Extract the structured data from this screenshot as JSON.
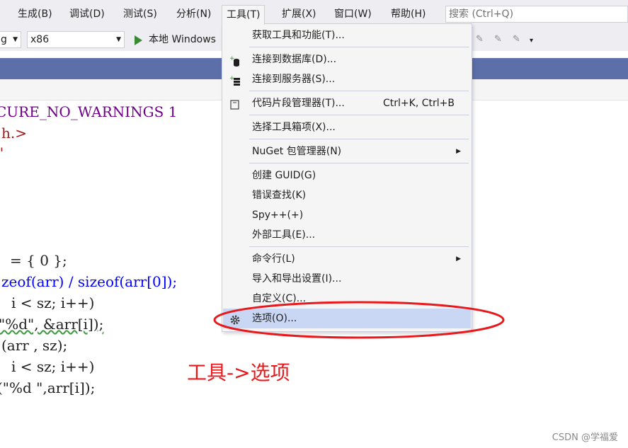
{
  "menubar": {
    "items": [
      "生成(B)",
      "调试(D)",
      "测试(S)",
      "分析(N)",
      "工具(T)",
      "扩展(X)",
      "窗口(W)",
      "帮助(H)"
    ],
    "search_placeholder": "搜索 (Ctrl+Q)"
  },
  "toolbar": {
    "config_value": "g",
    "platform_value": "x86",
    "run_label": "本地 Windows"
  },
  "code_lines": [
    "CURE_NO_WARNINGS 1",
    "h.>",
    "\"",
    "= { 0 };",
    "zeof(arr) / sizeof(arr[0]);",
    "i < sz; i++)",
    "\"%d\", &arr[i]);",
    "(arr , sz);",
    "i < sz; i++)",
    "(\"%d \",arr[i]);"
  ],
  "tools_menu": {
    "items": [
      {
        "label": "获取工具和功能(T)...",
        "shortcut": "",
        "icon": "",
        "has_submenu": false
      },
      {
        "label": "连接到数据库(D)...",
        "shortcut": "",
        "icon": "database-connect-icon",
        "has_submenu": false
      },
      {
        "label": "连接到服务器(S)...",
        "shortcut": "",
        "icon": "server-connect-icon",
        "has_submenu": false
      },
      {
        "label": "代码片段管理器(T)...",
        "shortcut": "Ctrl+K, Ctrl+B",
        "icon": "snippet-icon",
        "has_submenu": false
      },
      {
        "label": "选择工具箱项(X)...",
        "shortcut": "",
        "icon": "",
        "has_submenu": false
      },
      {
        "label": "NuGet 包管理器(N)",
        "shortcut": "",
        "icon": "",
        "has_submenu": true
      },
      {
        "label": "创建 GUID(G)",
        "shortcut": "",
        "icon": "",
        "has_submenu": false
      },
      {
        "label": "错误查找(K)",
        "shortcut": "",
        "icon": "",
        "has_submenu": false
      },
      {
        "label": "Spy++(+)",
        "shortcut": "",
        "icon": "",
        "has_submenu": false
      },
      {
        "label": "外部工具(E)...",
        "shortcut": "",
        "icon": "",
        "has_submenu": false
      },
      {
        "label": "命令行(L)",
        "shortcut": "",
        "icon": "",
        "has_submenu": true
      },
      {
        "label": "导入和导出设置(I)...",
        "shortcut": "",
        "icon": "",
        "has_submenu": false
      },
      {
        "label": "自定义(C)...",
        "shortcut": "",
        "icon": "",
        "has_submenu": false
      },
      {
        "label": "选项(O)...",
        "shortcut": "",
        "icon": "gear-icon",
        "has_submenu": false,
        "highlighted": true
      }
    ]
  },
  "annotation": {
    "text": "工具->选项",
    "color": "#e8191c"
  },
  "watermark": "CSDN @学福爱",
  "colors": {
    "tab_strip": "#5c6fa8",
    "menu_highlight": "#c9d7f4",
    "annotation_red": "#e8191c"
  }
}
